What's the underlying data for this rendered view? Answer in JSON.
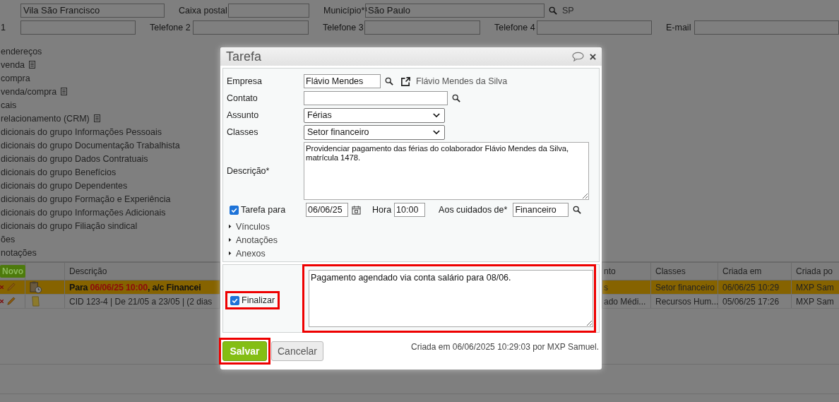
{
  "address": {
    "neighborhood": "Vila São Francisco",
    "po_box_label": "Caixa postal",
    "city_label": "Município*¹",
    "city": "São Paulo",
    "state": "SP"
  },
  "phones": {
    "row_label": "1",
    "phone2_label": "Telefone 2",
    "phone3_label": "Telefone 3",
    "phone4_label": "Telefone 4",
    "email_label": "E-mail"
  },
  "sections": [
    {
      "label": "endereços",
      "doc_icon": false
    },
    {
      "label": "venda",
      "doc_icon": true
    },
    {
      "label": "compra",
      "doc_icon": false
    },
    {
      "label": "venda/compra",
      "doc_icon": true
    },
    {
      "label": "cais",
      "doc_icon": false
    },
    {
      "label": "relacionamento (CRM)",
      "doc_icon": true
    },
    {
      "label": "dicionais do grupo Informações Pessoais",
      "doc_icon": false
    },
    {
      "label": "dicionais do grupo Documentação Trabalhista",
      "doc_icon": false
    },
    {
      "label": "dicionais do grupo Dados Contratuais",
      "doc_icon": false
    },
    {
      "label": "dicionais do grupo Benefícios",
      "doc_icon": false
    },
    {
      "label": "dicionais do grupo Dependentes",
      "doc_icon": false
    },
    {
      "label": "dicionais do grupo Formação e Experiência",
      "doc_icon": false
    },
    {
      "label": "dicionais do grupo Informações Adicionais",
      "doc_icon": false
    },
    {
      "label": "dicionais do grupo Filiação sindical",
      "doc_icon": false
    },
    {
      "label": "ões",
      "doc_icon": false
    },
    {
      "label": "notações",
      "doc_icon": false
    }
  ],
  "table": {
    "new_button": "Novo",
    "columns": [
      "Descrição",
      "nto",
      "Classes",
      "Criada em",
      "Criada po"
    ],
    "rows": [
      {
        "kind": "deadline",
        "selected": true,
        "description": {
          "prefix": "Para ",
          "date": "06/06/25 10:00",
          "suffix": ", a/c Financei"
        },
        "column_4": "s",
        "classes": "Setor financeiro",
        "created": "06/06/25 10:29",
        "created_by": "MXP Sam"
      },
      {
        "kind": "note",
        "selected": false,
        "description": "CID 123-4 | De 21/05 a 23/05 | (2 dias",
        "column_4": "ado Médi...",
        "classes": "Recursos Hum...",
        "created": "05/06/25 17:26",
        "created_by": "MXP Sam"
      }
    ]
  },
  "dialog": {
    "title": "Tarefa",
    "company": {
      "label": "Empresa",
      "value": "Flávio Mendes",
      "link": "Flávio Mendes da Silva"
    },
    "contact": {
      "label": "Contato"
    },
    "subject": {
      "label": "Assunto",
      "value": "Férias"
    },
    "classes": {
      "label": "Classes",
      "value": "Setor financeiro"
    },
    "description": {
      "label": "Descrição*",
      "value": "Providenciar pagamento das férias do colaborador Flávio Mendes da Silva, matrícula 1478."
    },
    "schedule": {
      "label": "Tarefa para",
      "checked": true,
      "date": "06/06/25",
      "time_label": "Hora",
      "time": "10:00",
      "assignee_label": "Aos cuidados de*",
      "assignee": "Financeiro"
    },
    "expanders": [
      {
        "label": "Vínculos",
        "expanded": false
      },
      {
        "label": "Anotações",
        "expanded": false
      },
      {
        "label": "Anexos",
        "expanded": false
      }
    ],
    "finalize": {
      "label": "Finalizar",
      "checked": true
    },
    "closing_note": "Pagamento agendado via conta salário para 08/06.",
    "save_button": "Salvar",
    "cancel_button": "Cancelar",
    "footer": "Criada em 06/06/2025 10:29:03 por MXP Samuel."
  }
}
